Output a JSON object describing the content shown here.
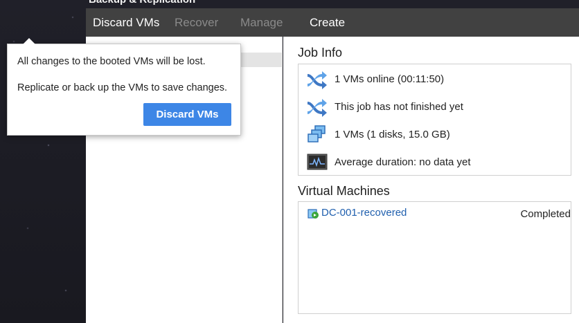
{
  "app": {
    "title": "Backup & Replication"
  },
  "menu": {
    "items": [
      {
        "label": "Discard VMs",
        "enabled": true
      },
      {
        "label": "Recover",
        "enabled": false
      },
      {
        "label": "Manage",
        "enabled": false
      },
      {
        "label": "Create",
        "enabled": true
      }
    ]
  },
  "popup": {
    "message_line1": "All changes to the booted VMs will be lost.",
    "message_line2": "Replicate or back up the VMs to save changes.",
    "button_label": "Discard VMs"
  },
  "job_info": {
    "title": "Job Info",
    "rows": [
      {
        "icon": "replication-icon",
        "text": "1 VMs online (00:11:50)"
      },
      {
        "icon": "replication-icon",
        "text": "This job has not finished yet"
      },
      {
        "icon": "vm-stack-icon",
        "text": "1 VMs (1 disks, 15.0 GB)"
      },
      {
        "icon": "monitor-chart-icon",
        "text": "Average duration: no data yet"
      }
    ]
  },
  "virtual_machines": {
    "title": "Virtual Machines",
    "items": [
      {
        "icon": "vm-recovered-icon",
        "name": "DC-001-recovered",
        "status": "Completed"
      }
    ]
  },
  "colors": {
    "accent": "#3d86e6",
    "menubar": "#414141",
    "link": "#1f5fae"
  }
}
